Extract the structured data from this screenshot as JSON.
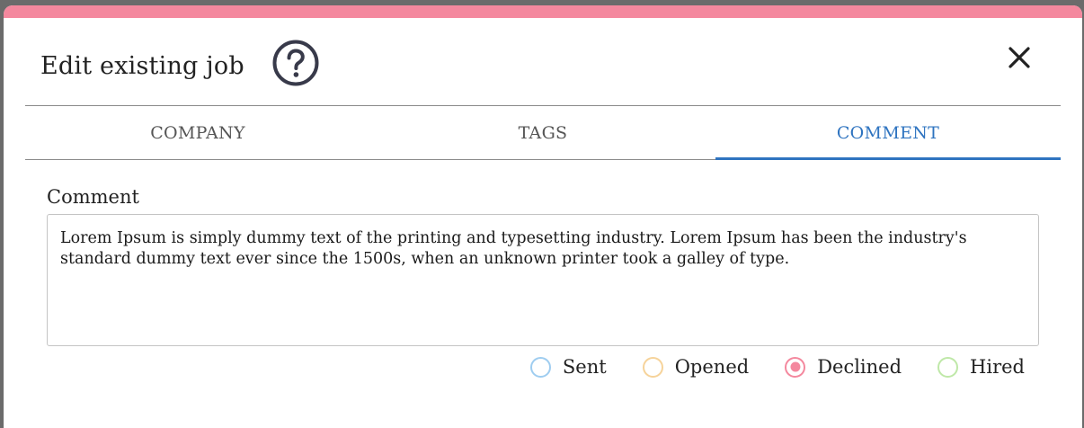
{
  "dialog": {
    "title": "Edit existing job",
    "help_icon": "question-circle-icon",
    "close_icon": "close-x-icon"
  },
  "colors": {
    "accent_bar": "#f4889e",
    "tab_active": "#2f74c0"
  },
  "tabs": [
    {
      "label": "COMPANY",
      "active": false
    },
    {
      "label": "TAGS",
      "active": false
    },
    {
      "label": "COMMENT",
      "active": true
    }
  ],
  "comment": {
    "label": "Comment",
    "value": "Lorem Ipsum is simply dummy text of the printing and typesetting industry. Lorem Ipsum has been the industry's standard dummy text ever since the 1500s, when an unknown printer took a galley of type."
  },
  "status_options": [
    {
      "label": "Sent",
      "color": "#9fcdf0",
      "selected": false
    },
    {
      "label": "Opened",
      "color": "#f6d39a",
      "selected": false
    },
    {
      "label": "Declined",
      "color": "#f4889e",
      "selected": true
    },
    {
      "label": "Hired",
      "color": "#bfe8a8",
      "selected": false
    }
  ]
}
